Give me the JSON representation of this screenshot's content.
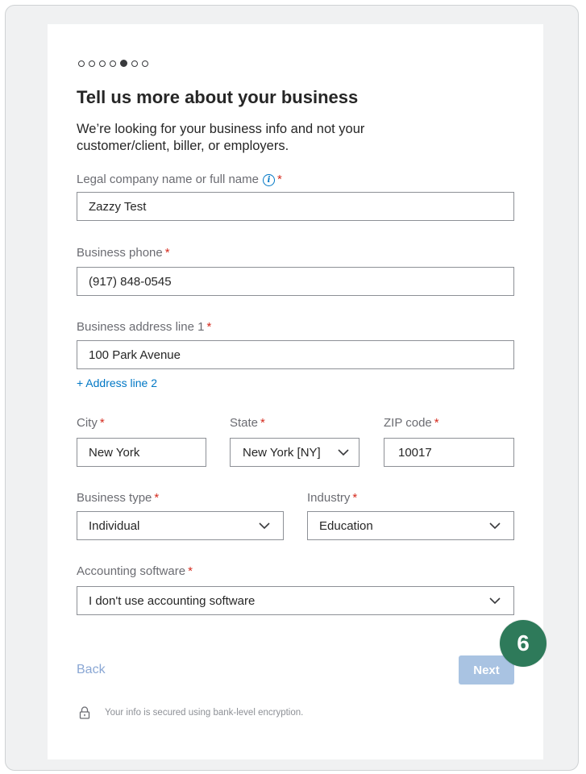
{
  "progress": {
    "total_steps": 7,
    "current_step": 5
  },
  "form": {
    "title": "Tell us more about your business",
    "subtitle": "We’re looking for your business info and not your customer/client, biller, or employers.",
    "legal_name": {
      "label": "Legal company name or full name",
      "value": "Zazzy Test"
    },
    "phone": {
      "label": "Business phone",
      "value": "(917) 848-0545"
    },
    "address1": {
      "label": "Business address line 1",
      "value": "100 Park Avenue"
    },
    "add_address_line2": "+ Address line 2",
    "city": {
      "label": "City",
      "value": "New York"
    },
    "state": {
      "label": "State",
      "value": "New York [NY]"
    },
    "zip": {
      "label": "ZIP code",
      "value": "10017"
    },
    "business_type": {
      "label": "Business type",
      "value": "Individual"
    },
    "industry": {
      "label": "Industry",
      "value": "Education"
    },
    "accounting_software": {
      "label": "Accounting software",
      "value": "I don't use accounting software"
    },
    "required_mark": "*"
  },
  "actions": {
    "back_label": "Back",
    "next_label": "Next"
  },
  "step_badge": "6",
  "footer": {
    "security_text": "Your info is secured using bank-level encryption."
  },
  "colors": {
    "accent_link": "#0077c5",
    "badge": "#2e7a5a",
    "next_disabled": "#a9c3e2",
    "required": "#d52b1e"
  }
}
